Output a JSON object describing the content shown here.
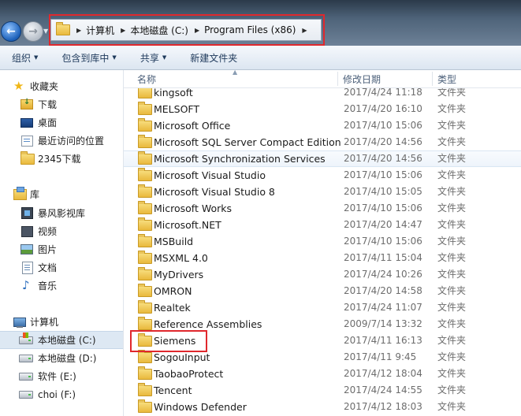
{
  "address": {
    "breadcrumbs": [
      "计算机",
      "本地磁盘 (C:)",
      "Program Files (x86)"
    ]
  },
  "toolbar": {
    "organize": "组织",
    "include_library": "包含到库中",
    "share": "共享",
    "new_folder": "新建文件夹"
  },
  "sidebar": {
    "favorites": "收藏夹",
    "downloads": "下载",
    "desktop": "桌面",
    "recent": "最近访问的位置",
    "dl2345": "2345下载",
    "libraries": "库",
    "baofeng": "暴风影视库",
    "videos": "视频",
    "pictures": "图片",
    "documents": "文档",
    "music": "音乐",
    "computer": "计算机",
    "drive_c": "本地磁盘 (C:)",
    "drive_d": "本地磁盘 (D:)",
    "drive_e": "软件 (E:)",
    "drive_f": "choi (F:)"
  },
  "columns": {
    "name": "名称",
    "date": "修改日期",
    "type": "类型"
  },
  "files": [
    {
      "name": "kingsoft",
      "date": "2017/4/24 11:18",
      "type": "文件夹"
    },
    {
      "name": "MELSOFT",
      "date": "2017/4/20 16:10",
      "type": "文件夹"
    },
    {
      "name": "Microsoft Office",
      "date": "2017/4/10 15:06",
      "type": "文件夹"
    },
    {
      "name": "Microsoft SQL Server Compact Edition",
      "date": "2017/4/20 14:56",
      "type": "文件夹"
    },
    {
      "name": "Microsoft Synchronization Services",
      "date": "2017/4/20 14:56",
      "type": "文件夹"
    },
    {
      "name": "Microsoft Visual Studio",
      "date": "2017/4/10 15:06",
      "type": "文件夹"
    },
    {
      "name": "Microsoft Visual Studio 8",
      "date": "2017/4/10 15:05",
      "type": "文件夹"
    },
    {
      "name": "Microsoft Works",
      "date": "2017/4/10 15:06",
      "type": "文件夹"
    },
    {
      "name": "Microsoft.NET",
      "date": "2017/4/20 14:47",
      "type": "文件夹"
    },
    {
      "name": "MSBuild",
      "date": "2017/4/10 15:06",
      "type": "文件夹"
    },
    {
      "name": "MSXML 4.0",
      "date": "2017/4/11 15:04",
      "type": "文件夹"
    },
    {
      "name": "MyDrivers",
      "date": "2017/4/24 10:26",
      "type": "文件夹"
    },
    {
      "name": "OMRON",
      "date": "2017/4/20 14:58",
      "type": "文件夹"
    },
    {
      "name": "Realtek",
      "date": "2017/4/24 11:07",
      "type": "文件夹"
    },
    {
      "name": "Reference Assemblies",
      "date": "2009/7/14 13:32",
      "type": "文件夹"
    },
    {
      "name": "Siemens",
      "date": "2017/4/11 16:13",
      "type": "文件夹"
    },
    {
      "name": "SogouInput",
      "date": "2017/4/11 9:45",
      "type": "文件夹"
    },
    {
      "name": "TaobaoProtect",
      "date": "2017/4/12 18:04",
      "type": "文件夹"
    },
    {
      "name": "Tencent",
      "date": "2017/4/24 14:55",
      "type": "文件夹"
    },
    {
      "name": "Windows Defender",
      "date": "2017/4/12 18:03",
      "type": "文件夹"
    }
  ],
  "highlight_color": "#e0282d"
}
